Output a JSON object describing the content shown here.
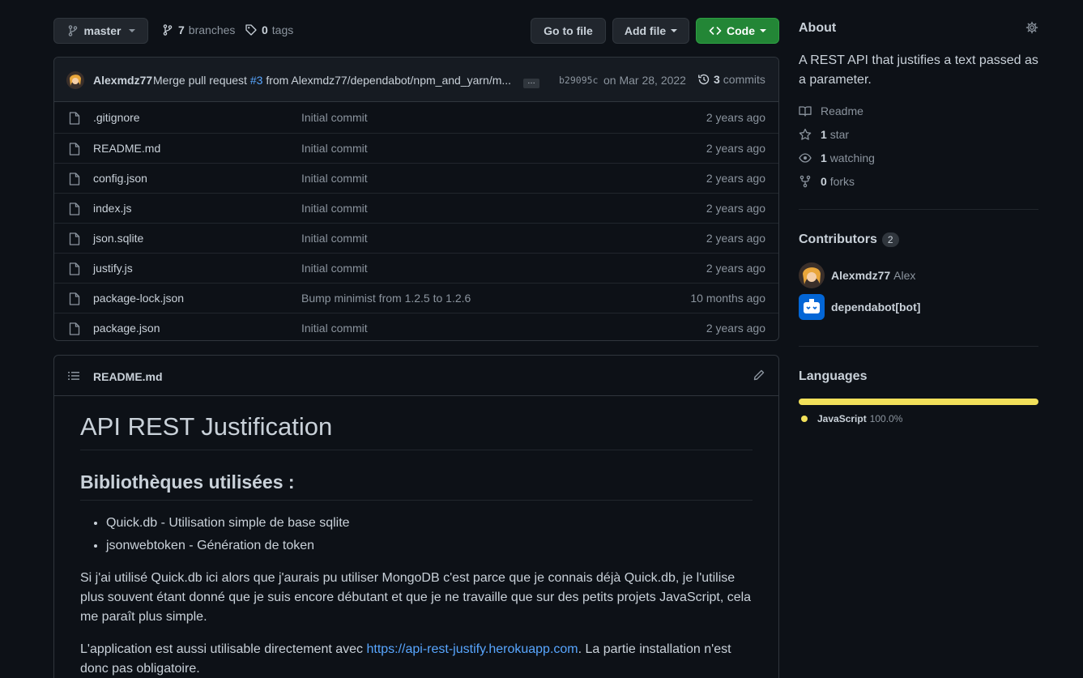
{
  "toolbar": {
    "branch": "master",
    "branches_count": "7",
    "branches_label": "branches",
    "tags_count": "0",
    "tags_label": "tags",
    "go_to_file": "Go to file",
    "add_file": "Add file",
    "code": "Code"
  },
  "commit": {
    "author": "Alexmdz77",
    "message_pre": "Merge pull request",
    "pr_link": "#3",
    "message_post": "from Alexmdz77/dependabot/npm_and_yarn/m...",
    "ellipsis": "…",
    "sha": "b29095c",
    "date": "on Mar 28, 2022",
    "commits_count": "3",
    "commits_label": "commits"
  },
  "files": [
    {
      "name": ".gitignore",
      "message": "Initial commit",
      "age": "2 years ago"
    },
    {
      "name": "README.md",
      "message": "Initial commit",
      "age": "2 years ago"
    },
    {
      "name": "config.json",
      "message": "Initial commit",
      "age": "2 years ago"
    },
    {
      "name": "index.js",
      "message": "Initial commit",
      "age": "2 years ago"
    },
    {
      "name": "json.sqlite",
      "message": "Initial commit",
      "age": "2 years ago"
    },
    {
      "name": "justify.js",
      "message": "Initial commit",
      "age": "2 years ago"
    },
    {
      "name": "package-lock.json",
      "message": "Bump minimist from 1.2.5 to 1.2.6",
      "age": "10 months ago"
    },
    {
      "name": "package.json",
      "message": "Initial commit",
      "age": "2 years ago"
    }
  ],
  "readme": {
    "filename": "README.md",
    "h1": "API REST Justification",
    "h2": "Bibliothèques utilisées :",
    "bullets": [
      "Quick.db - Utilisation simple de base sqlite",
      "jsonwebtoken - Génération de token"
    ],
    "p1": "Si j'ai utilisé Quick.db ici alors que j'aurais pu utiliser MongoDB c'est parce que je connais déjà Quick.db, je l'utilise plus souvent étant donné que je suis encore débutant et que je ne travaille que sur des petits projets JavaScript, cela me paraît plus simple.",
    "p2_pre": "L'application est aussi utilisable directement avec ",
    "p2_link": "https://api-rest-justify.herokuapp.com",
    "p2_post": ". La partie installation n'est donc pas obligatoire."
  },
  "about": {
    "title": "About",
    "description": "A REST API that justifies a text passed as a parameter.",
    "readme": "Readme",
    "stars_count": "1",
    "stars_label": "star",
    "watching_count": "1",
    "watching_label": "watching",
    "forks_count": "0",
    "forks_label": "forks"
  },
  "contributors": {
    "title": "Contributors",
    "count": "2",
    "list": [
      {
        "login": "Alexmdz77",
        "name": "Alex"
      },
      {
        "login": "dependabot[bot]",
        "name": ""
      }
    ]
  },
  "languages": {
    "title": "Languages",
    "items": [
      {
        "name": "JavaScript",
        "percent": "100.0%",
        "color": "#f1e05a",
        "fraction": 1.0
      }
    ]
  },
  "colors": {
    "background": "#0d1117",
    "border": "#30363d",
    "button_green": "#238636",
    "link": "#58a6ff",
    "javascript": "#f1e05a"
  }
}
